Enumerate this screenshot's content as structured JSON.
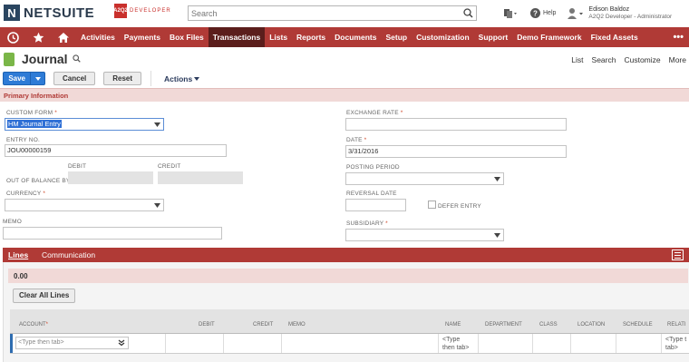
{
  "topbar": {
    "logo_mark": "N",
    "logo_text": "NETSUITE",
    "partner_mark": "A2Q2",
    "partner_text": "DEVELOPER",
    "search_placeholder": "Search",
    "help_label": "Help",
    "user_name": "Edison Baldoz",
    "user_role": "A2Q2 Developer - Administrator"
  },
  "nav": {
    "items": [
      "Activities",
      "Payments",
      "Box Files",
      "Transactions",
      "Lists",
      "Reports",
      "Documents",
      "Setup",
      "Customization",
      "Support",
      "Demo Framework",
      "Fixed Assets"
    ],
    "active": "Transactions",
    "more": "•••"
  },
  "page": {
    "title": "Journal",
    "links": [
      "List",
      "Search",
      "Customize",
      "More"
    ]
  },
  "toolbar": {
    "save": "Save",
    "cancel": "Cancel",
    "reset": "Reset",
    "actions": "Actions"
  },
  "section": {
    "primary": "Primary Information"
  },
  "form": {
    "custom_form_label": "CUSTOM FORM",
    "custom_form_value": "HM Journal Entry",
    "entry_no_label": "ENTRY NO.",
    "entry_no_value": "JOU00000159",
    "debit_label": "DEBIT",
    "credit_label": "CREDIT",
    "out_of_balance_label": "OUT OF BALANCE BY",
    "currency_label": "CURRENCY",
    "memo_label": "MEMO",
    "exchange_rate_label": "EXCHANGE RATE",
    "date_label": "DATE",
    "date_value": "3/31/2016",
    "posting_period_label": "POSTING PERIOD",
    "reversal_date_label": "REVERSAL DATE",
    "defer_entry_label": "DEFER ENTRY",
    "subsidiary_label": "SUBSIDIARY",
    "required_mark": "*"
  },
  "lines": {
    "tabs": [
      "Lines",
      "Communication"
    ],
    "total": "0.00",
    "clear_button": "Clear All Lines",
    "columns": [
      "ACCOUNT",
      "DEBIT",
      "CREDIT",
      "MEMO",
      "NAME",
      "DEPARTMENT",
      "CLASS",
      "LOCATION",
      "SCHEDULE",
      "RELATI"
    ],
    "account_placeholder": "<Type then tab>",
    "name_placeholder_1": "<Type",
    "name_placeholder_2": "then tab>",
    "rel_placeholder_1": "<Type t",
    "rel_placeholder_2": "tab>"
  },
  "colors": {
    "nav": "#b03a36",
    "nav_active": "#5b1e1c",
    "section": "#f1d9d7",
    "save": "#2e7bd6"
  }
}
